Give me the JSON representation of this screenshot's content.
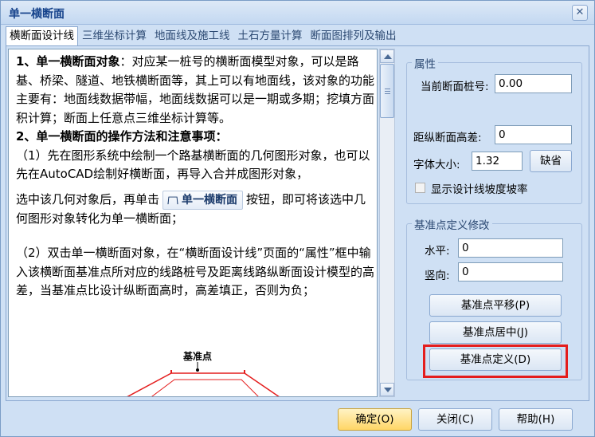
{
  "window": {
    "title": "单一横断面",
    "close_glyph": "✕"
  },
  "tabs": [
    {
      "label": "横断面设计线",
      "active": true
    },
    {
      "label": "三维坐标计算",
      "active": false
    },
    {
      "label": "地面线及施工线",
      "active": false
    },
    {
      "label": "土石方量计算",
      "active": false
    },
    {
      "label": "断面图排列及输出",
      "active": false
    }
  ],
  "help": {
    "p1_title": "1、单一横断面对象",
    "p1_body": "：对应某一桩号的横断面模型对象，可以是路基、桥梁、隧道、地铁横断面等，其上可以有地面线，该对象的功能主要有：地面线数据带幅，地面线数据可以是一期或多期；挖填方面积计算；断面上任意点三维坐标计算等。",
    "p2_title": "2、单一横断面的操作方法和注意事项：",
    "p3": "（1）先在图形系统中绘制一个路基横断面的几何图形对象，也可以先在AutoCAD绘制好横断面，再导入合并成图形对象，",
    "p4_before": "选中该几何对象后，再单击",
    "p4_button": "单一横断面",
    "p4_after": "按钮，即可将该选中几何图形对象转化为单一横断面；",
    "p5": "（2）双击单一横断面对象，在“横断面设计线”页面的“属性”框中输入该横断面基准点所对应的线路桩号及距离线路纵断面设计模型的高差，当基准点比设计纵断面高时，高差填正，否则为负；",
    "diagram_label": "基准点"
  },
  "properties": {
    "legend": "属性",
    "station_label": "当前断面桩号:",
    "station_value": "0.00",
    "elev_label": "距纵断面高差:",
    "elev_value": "0",
    "font_label": "字体大小:",
    "font_value": "1.32",
    "default_button": "缺省",
    "show_slope_label": "显示设计线坡度坡率",
    "show_slope_checked": false
  },
  "datum": {
    "legend": "基准点定义修改",
    "horizontal_label": "水平:",
    "horizontal_value": "0",
    "vertical_label": "竖向:",
    "vertical_value": "0",
    "move_button": "基准点平移(P)",
    "center_button": "基准点居中(J)",
    "define_button": "基准点定义(D)"
  },
  "footer": {
    "ok_button": "确定(O)",
    "close_button": "关闭(C)",
    "help_button": "帮助(H)"
  },
  "colors": {
    "highlight": "#e41d1d",
    "accent": "#15428b"
  }
}
